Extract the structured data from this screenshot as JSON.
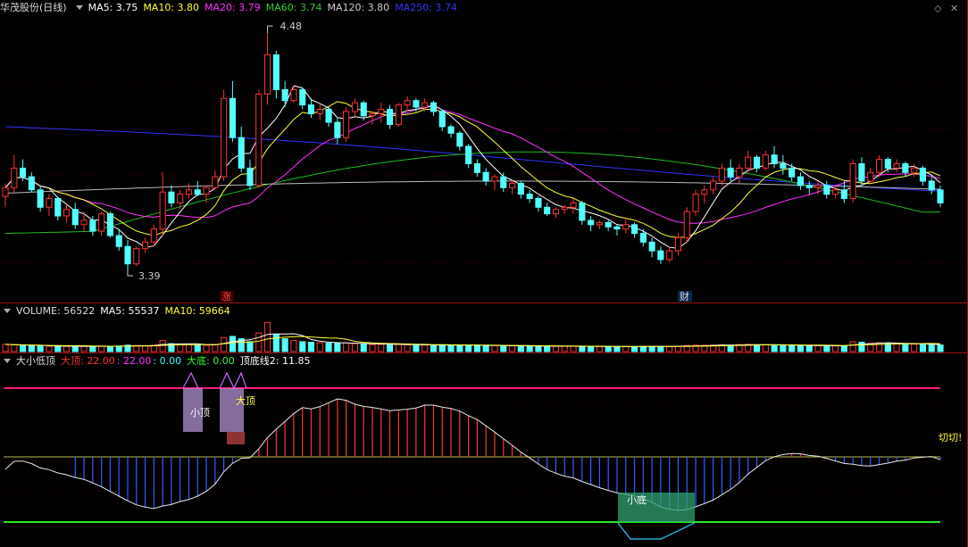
{
  "main": {
    "stock_name": "华茂股份(日线)",
    "ma": [
      {
        "label": "MA5: 3.75",
        "color": "#ffffff"
      },
      {
        "label": "MA10: 3.80",
        "color": "#ffff33"
      },
      {
        "label": "MA20: 3.79",
        "color": "#ff33ff"
      },
      {
        "label": "MA60: 3.74",
        "color": "#33cc33"
      },
      {
        "label": "MA120: 3.80",
        "color": "#cccccc"
      },
      {
        "label": "MA250: 3.74",
        "color": "#3333ff"
      }
    ],
    "high_label": "4.48",
    "low_label": "3.39",
    "marker_zhang": "涨",
    "marker_cai": "财"
  },
  "volume": {
    "title": "VOLUME: 56522",
    "ma5": "MA5: 55537",
    "ma10": "MA10: 59664"
  },
  "indicator": {
    "title": "大小低顶",
    "items": [
      {
        "label": "大顶: 22.00",
        "color": "#ff3333"
      },
      {
        "label": ": 22.00",
        "color": "#ff33ff"
      },
      {
        "label": ": 0.00",
        "color": "#33ffff"
      },
      {
        "label": "大底: 0.00",
        "color": "#33ff33"
      },
      {
        "label": "顶底线2: 11.85",
        "color": "#ffffff"
      }
    ],
    "label_small_top": "小顶",
    "label_big_top": "大顶",
    "label_small_bottom": "小底",
    "label_cut": "切切!"
  },
  "colors": {
    "up": "#ff3232",
    "down": "#54ffff",
    "bg": "#000000",
    "grid": "#8b0000"
  },
  "chart_data": {
    "type": "candlestick",
    "ylim": [
      3.3,
      4.55
    ],
    "candles": [
      [
        3.73,
        3.79,
        3.68,
        3.77
      ],
      [
        3.77,
        3.92,
        3.75,
        3.86
      ],
      [
        3.86,
        3.9,
        3.8,
        3.82
      ],
      [
        3.82,
        3.84,
        3.75,
        3.76
      ],
      [
        3.76,
        3.78,
        3.66,
        3.68
      ],
      [
        3.68,
        3.74,
        3.64,
        3.72
      ],
      [
        3.72,
        3.73,
        3.62,
        3.64
      ],
      [
        3.64,
        3.7,
        3.61,
        3.67
      ],
      [
        3.67,
        3.7,
        3.58,
        3.6
      ],
      [
        3.6,
        3.66,
        3.57,
        3.62
      ],
      [
        3.62,
        3.64,
        3.55,
        3.57
      ],
      [
        3.57,
        3.66,
        3.55,
        3.65
      ],
      [
        3.65,
        3.66,
        3.54,
        3.55
      ],
      [
        3.55,
        3.58,
        3.48,
        3.5
      ],
      [
        3.5,
        3.53,
        3.39,
        3.42
      ],
      [
        3.42,
        3.5,
        3.41,
        3.49
      ],
      [
        3.49,
        3.54,
        3.47,
        3.52
      ],
      [
        3.52,
        3.6,
        3.5,
        3.58
      ],
      [
        3.58,
        3.84,
        3.55,
        3.75
      ],
      [
        3.75,
        3.78,
        3.68,
        3.7
      ],
      [
        3.7,
        3.76,
        3.67,
        3.74
      ],
      [
        3.74,
        3.79,
        3.72,
        3.76
      ],
      [
        3.76,
        3.8,
        3.73,
        3.74
      ],
      [
        3.74,
        3.78,
        3.7,
        3.77
      ],
      [
        3.77,
        3.85,
        3.76,
        3.82
      ],
      [
        3.82,
        4.22,
        3.8,
        4.18
      ],
      [
        4.18,
        4.26,
        3.98,
        4.0
      ],
      [
        4.0,
        4.05,
        3.84,
        3.86
      ],
      [
        3.86,
        3.9,
        3.76,
        3.78
      ],
      [
        3.78,
        4.22,
        3.77,
        4.2
      ],
      [
        4.2,
        4.48,
        4.15,
        4.38
      ],
      [
        4.38,
        4.4,
        4.18,
        4.22
      ],
      [
        4.22,
        4.26,
        4.14,
        4.17
      ],
      [
        4.17,
        4.24,
        4.16,
        4.22
      ],
      [
        4.22,
        4.23,
        4.13,
        4.15
      ],
      [
        4.15,
        4.18,
        4.09,
        4.11
      ],
      [
        4.11,
        4.16,
        4.08,
        4.13
      ],
      [
        4.13,
        4.14,
        4.05,
        4.07
      ],
      [
        4.07,
        4.09,
        3.97,
        4.0
      ],
      [
        4.0,
        4.14,
        3.98,
        4.12
      ],
      [
        4.12,
        4.18,
        4.1,
        4.16
      ],
      [
        4.16,
        4.17,
        4.08,
        4.1
      ],
      [
        4.1,
        4.12,
        4.06,
        4.11
      ],
      [
        4.11,
        4.16,
        4.07,
        4.13
      ],
      [
        4.13,
        4.15,
        4.04,
        4.06
      ],
      [
        4.06,
        4.16,
        4.05,
        4.15
      ],
      [
        4.15,
        4.19,
        4.12,
        4.17
      ],
      [
        4.17,
        4.18,
        4.12,
        4.14
      ],
      [
        4.14,
        4.18,
        4.12,
        4.16
      ],
      [
        4.16,
        4.17,
        4.1,
        4.12
      ],
      [
        4.12,
        4.13,
        4.03,
        4.05
      ],
      [
        4.05,
        4.06,
        4.0,
        4.02
      ],
      [
        4.02,
        4.03,
        3.94,
        3.96
      ],
      [
        3.96,
        3.97,
        3.86,
        3.88
      ],
      [
        3.88,
        3.9,
        3.82,
        3.84
      ],
      [
        3.84,
        3.86,
        3.78,
        3.8
      ],
      [
        3.8,
        3.83,
        3.76,
        3.82
      ],
      [
        3.82,
        3.84,
        3.75,
        3.77
      ],
      [
        3.77,
        3.81,
        3.74,
        3.79
      ],
      [
        3.79,
        3.8,
        3.72,
        3.74
      ],
      [
        3.74,
        3.76,
        3.7,
        3.72
      ],
      [
        3.72,
        3.73,
        3.66,
        3.68
      ],
      [
        3.68,
        3.7,
        3.64,
        3.65
      ],
      [
        3.65,
        3.68,
        3.63,
        3.67
      ],
      [
        3.67,
        3.69,
        3.65,
        3.68
      ],
      [
        3.68,
        3.72,
        3.65,
        3.7
      ],
      [
        3.7,
        3.71,
        3.6,
        3.62
      ],
      [
        3.62,
        3.64,
        3.57,
        3.6
      ],
      [
        3.6,
        3.62,
        3.58,
        3.61
      ],
      [
        3.61,
        3.62,
        3.57,
        3.59
      ],
      [
        3.59,
        3.6,
        3.55,
        3.58
      ],
      [
        3.58,
        3.63,
        3.56,
        3.6
      ],
      [
        3.6,
        3.61,
        3.54,
        3.56
      ],
      [
        3.56,
        3.58,
        3.5,
        3.52
      ],
      [
        3.52,
        3.54,
        3.45,
        3.48
      ],
      [
        3.48,
        3.5,
        3.42,
        3.44
      ],
      [
        3.44,
        3.5,
        3.43,
        3.48
      ],
      [
        3.48,
        3.56,
        3.46,
        3.54
      ],
      [
        3.54,
        3.68,
        3.52,
        3.66
      ],
      [
        3.66,
        3.76,
        3.64,
        3.74
      ],
      [
        3.74,
        3.78,
        3.7,
        3.76
      ],
      [
        3.76,
        3.82,
        3.74,
        3.8
      ],
      [
        3.8,
        3.88,
        3.78,
        3.86
      ],
      [
        3.86,
        3.9,
        3.8,
        3.82
      ],
      [
        3.82,
        3.88,
        3.79,
        3.86
      ],
      [
        3.86,
        3.94,
        3.84,
        3.91
      ],
      [
        3.91,
        3.92,
        3.84,
        3.86
      ],
      [
        3.86,
        3.94,
        3.85,
        3.92
      ],
      [
        3.92,
        3.96,
        3.86,
        3.88
      ],
      [
        3.88,
        3.92,
        3.83,
        3.86
      ],
      [
        3.86,
        3.88,
        3.8,
        3.82
      ],
      [
        3.82,
        3.84,
        3.76,
        3.78
      ],
      [
        3.78,
        3.8,
        3.74,
        3.77
      ],
      [
        3.77,
        3.8,
        3.74,
        3.78
      ],
      [
        3.78,
        3.8,
        3.72,
        3.74
      ],
      [
        3.74,
        3.78,
        3.72,
        3.76
      ],
      [
        3.76,
        3.8,
        3.7,
        3.72
      ],
      [
        3.72,
        3.9,
        3.7,
        3.88
      ],
      [
        3.88,
        3.91,
        3.78,
        3.8
      ],
      [
        3.8,
        3.86,
        3.79,
        3.84
      ],
      [
        3.84,
        3.92,
        3.82,
        3.9
      ],
      [
        3.9,
        3.91,
        3.84,
        3.86
      ],
      [
        3.86,
        3.9,
        3.84,
        3.88
      ],
      [
        3.88,
        3.89,
        3.82,
        3.84
      ],
      [
        3.84,
        3.88,
        3.82,
        3.86
      ],
      [
        3.86,
        3.87,
        3.78,
        3.8
      ],
      [
        3.8,
        3.82,
        3.74,
        3.76
      ],
      [
        3.76,
        3.78,
        3.68,
        3.7
      ]
    ],
    "volume": [
      62000,
      58000,
      52000,
      50000,
      48000,
      46000,
      45000,
      44000,
      46000,
      45000,
      44000,
      47000,
      45000,
      48000,
      55000,
      52000,
      50000,
      54000,
      95000,
      68000,
      60000,
      58000,
      55000,
      54000,
      60000,
      120000,
      130000,
      110000,
      85000,
      160000,
      250000,
      150000,
      110000,
      95000,
      85000,
      80000,
      75000,
      72000,
      70000,
      75000,
      68000,
      64000,
      60000,
      62000,
      60000,
      63000,
      58000,
      55000,
      56000,
      54000,
      58000,
      56000,
      55000,
      54000,
      52000,
      50000,
      52000,
      50000,
      49000,
      48000,
      48000,
      47000,
      46000,
      45000,
      45000,
      46000,
      44000,
      44000,
      43000,
      44000,
      42000,
      43000,
      42000,
      44000,
      45000,
      46000,
      44000,
      45000,
      52000,
      55000,
      54000,
      56000,
      58000,
      55000,
      60000,
      62000,
      58000,
      60000,
      56000,
      55000,
      52000,
      50000,
      50000,
      52000,
      50000,
      49000,
      48000,
      85000,
      80000,
      70000,
      75000,
      68000,
      70000,
      66000,
      64000,
      60000,
      58000,
      56522
    ]
  }
}
